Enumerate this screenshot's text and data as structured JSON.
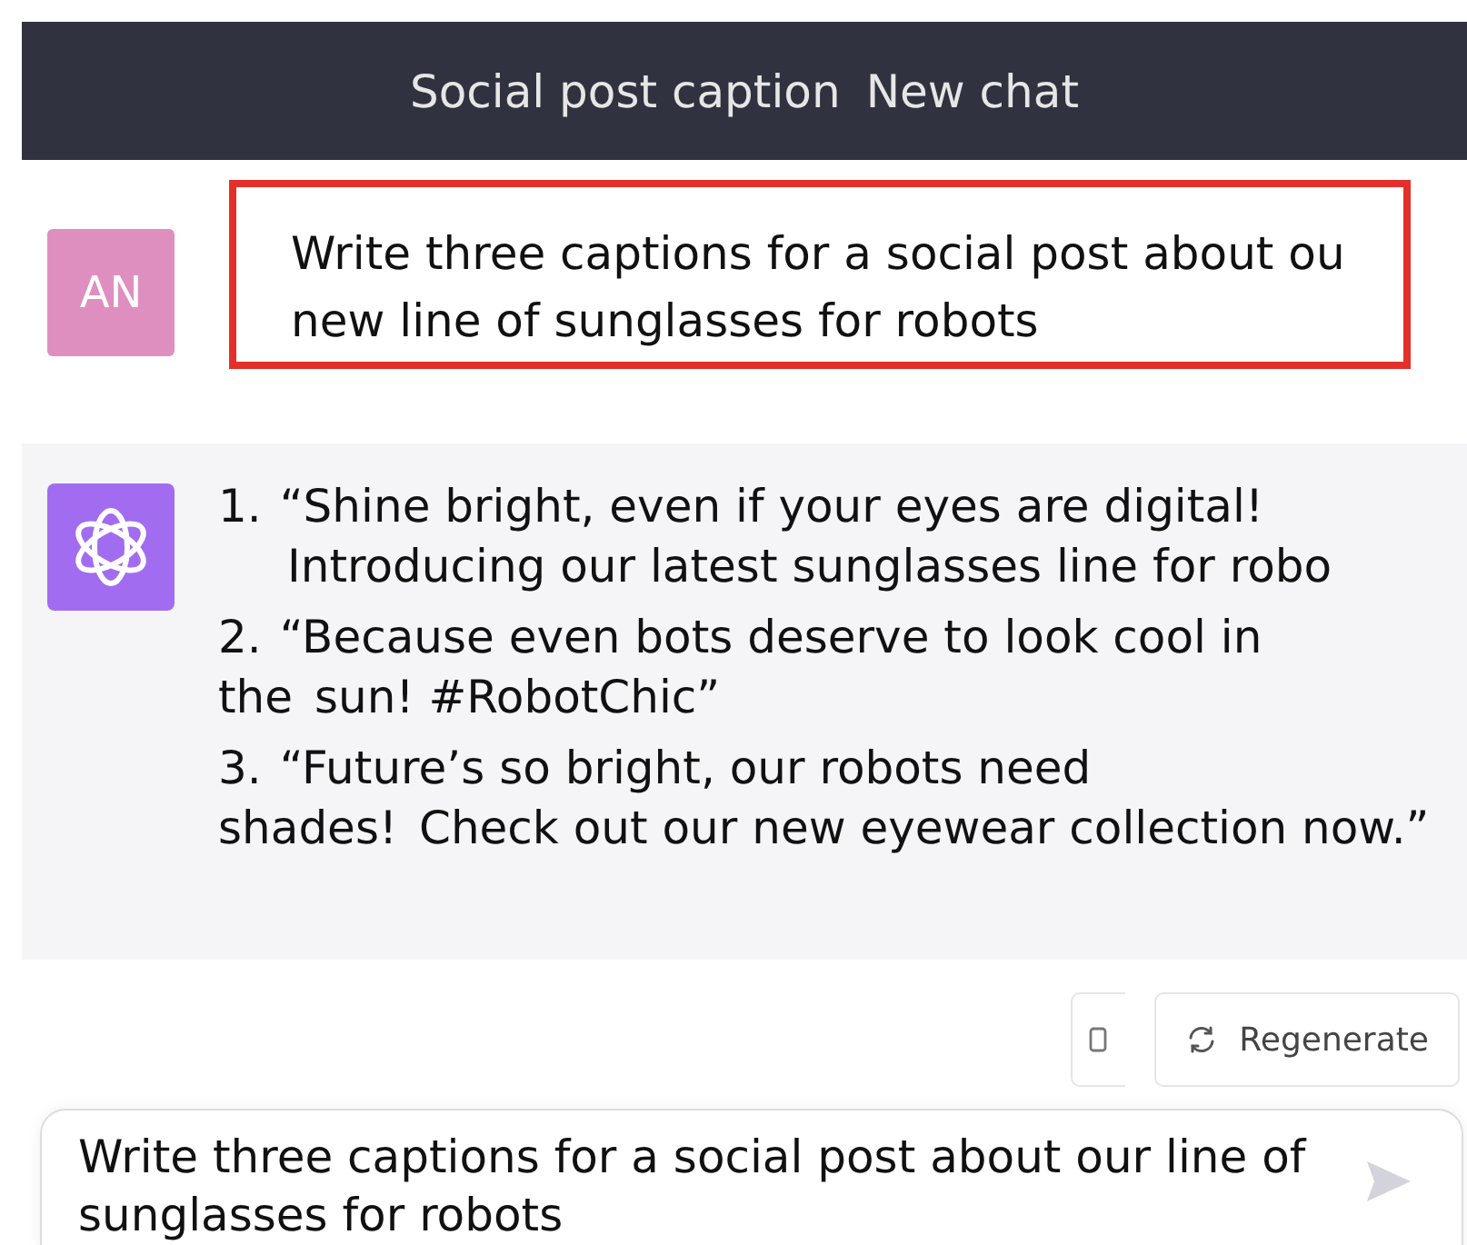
{
  "header": {
    "title": "Social post caption",
    "overlay_title": "New chat"
  },
  "user_message": {
    "avatar": "AN",
    "lines": [
      "Write three captions for a social post about ou",
      "new line of sunglasses for robots"
    ],
    "highlighted": true
  },
  "assistant_message": {
    "items": [
      {
        "number": "1.",
        "lines": [
          "“Shine bright, even if your eyes are digital!",
          "Introducing our latest sunglasses line for robo"
        ],
        "kind": "hanging"
      },
      {
        "number": "2.",
        "lines": [
          "“Because even bots deserve to look cool in",
          "the"
        ],
        "overlay": "sun! #RobotChic”",
        "kind": "overlap"
      },
      {
        "number": "3.",
        "lines": [
          "“Future’s so bright, our robots need",
          "shades!"
        ],
        "overlay": "Check out our new eyewear collection now.”",
        "kind": "overlap"
      }
    ]
  },
  "actions": {
    "regenerate": "Regenerate"
  },
  "composer": {
    "value": "Write three captions for a social post about our line of sunglasses for robots"
  }
}
